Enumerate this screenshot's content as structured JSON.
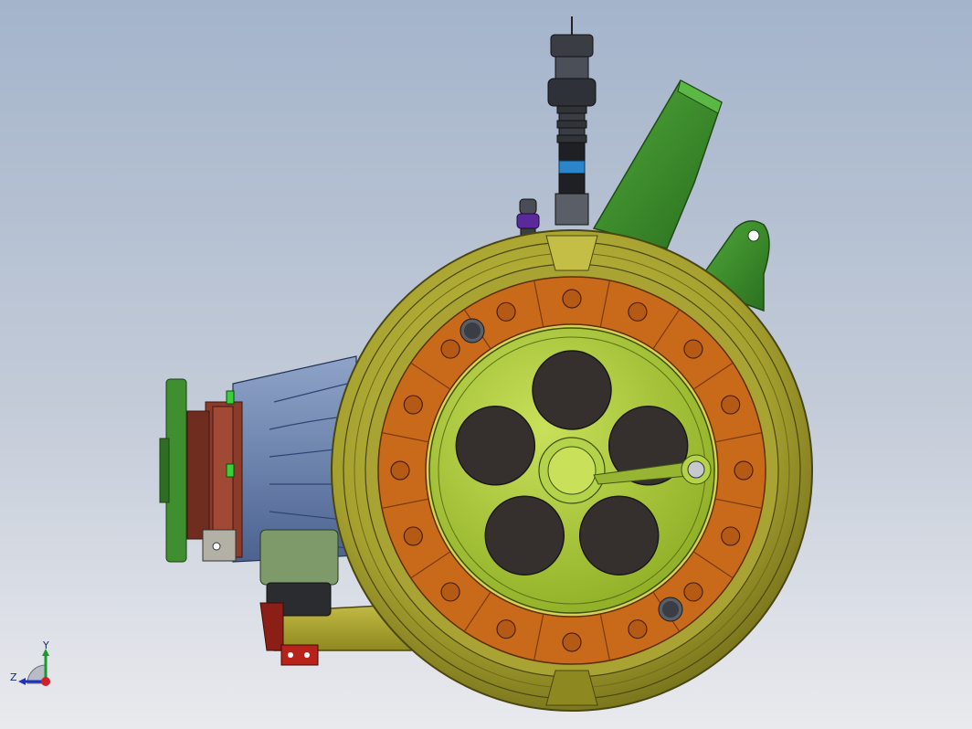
{
  "viewport": {
    "background_top": "#a4b4cb",
    "background_bottom": "#e9eaee"
  },
  "model": {
    "colors": {
      "drum": "#a6a12f",
      "drum_dark": "#6e6a18",
      "friction_segment": "#c96a1b",
      "hub_plate": "#a9c73a",
      "holes": "#35302e",
      "bracket": "#3e8e2a",
      "housing": "#6d84ad",
      "flange": "#8c3a2a",
      "cable_blue": "#2a86c9",
      "fitting_purple": "#5a2a9a"
    }
  },
  "triad": {
    "x_label": "",
    "y_label": "Y",
    "z_label": "Z",
    "x_color": "#d0202a",
    "y_color": "#1a9a2a",
    "z_color": "#2030c0"
  }
}
